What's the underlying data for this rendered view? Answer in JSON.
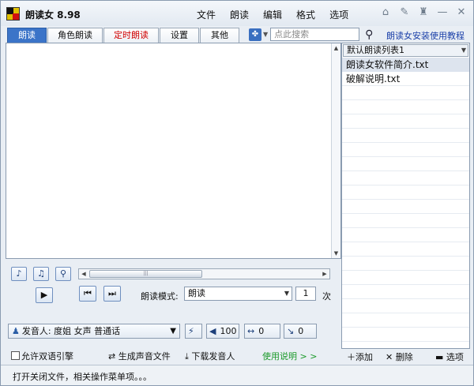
{
  "window": {
    "title": "朗读女 8.98"
  },
  "menu": [
    "文件",
    "朗读",
    "编辑",
    "格式",
    "选项"
  ],
  "tabs": [
    {
      "label": "朗读"
    },
    {
      "label": "角色朗读"
    },
    {
      "label": "定时朗读"
    },
    {
      "label": "设置"
    },
    {
      "label": "其他"
    }
  ],
  "search": {
    "placeholder": "点此搜索"
  },
  "help_link": "朗读女安装使用教程",
  "playlist": {
    "name": "默认朗读列表1",
    "items": [
      "朗读女软件简介.txt",
      "破解说明.txt"
    ]
  },
  "controls": {
    "mode_label": "朗读模式:",
    "mode_value": "朗读",
    "repeat_count": "1",
    "repeat_unit": "次"
  },
  "voice": {
    "label": "发音人:",
    "value": "度姐 女声 普通话",
    "volume": "100",
    "speed": "0",
    "pitch": "0"
  },
  "bottom": {
    "bilingual": "允许双语引擎",
    "generate": "生成声音文件",
    "download": "下载发音人",
    "usage": "使用说明",
    "usage_arrows": "> >"
  },
  "playlist_actions": {
    "add": "添加",
    "delete": "删除",
    "options": "选项"
  },
  "status": "打开关闭文件，相关操作菜单项。。。",
  "colors": {
    "active_tab": "#3b74c8",
    "timer_tab_text": "#d00000",
    "link": "#1a3fa8",
    "usage_link": "#1b9a2a"
  }
}
